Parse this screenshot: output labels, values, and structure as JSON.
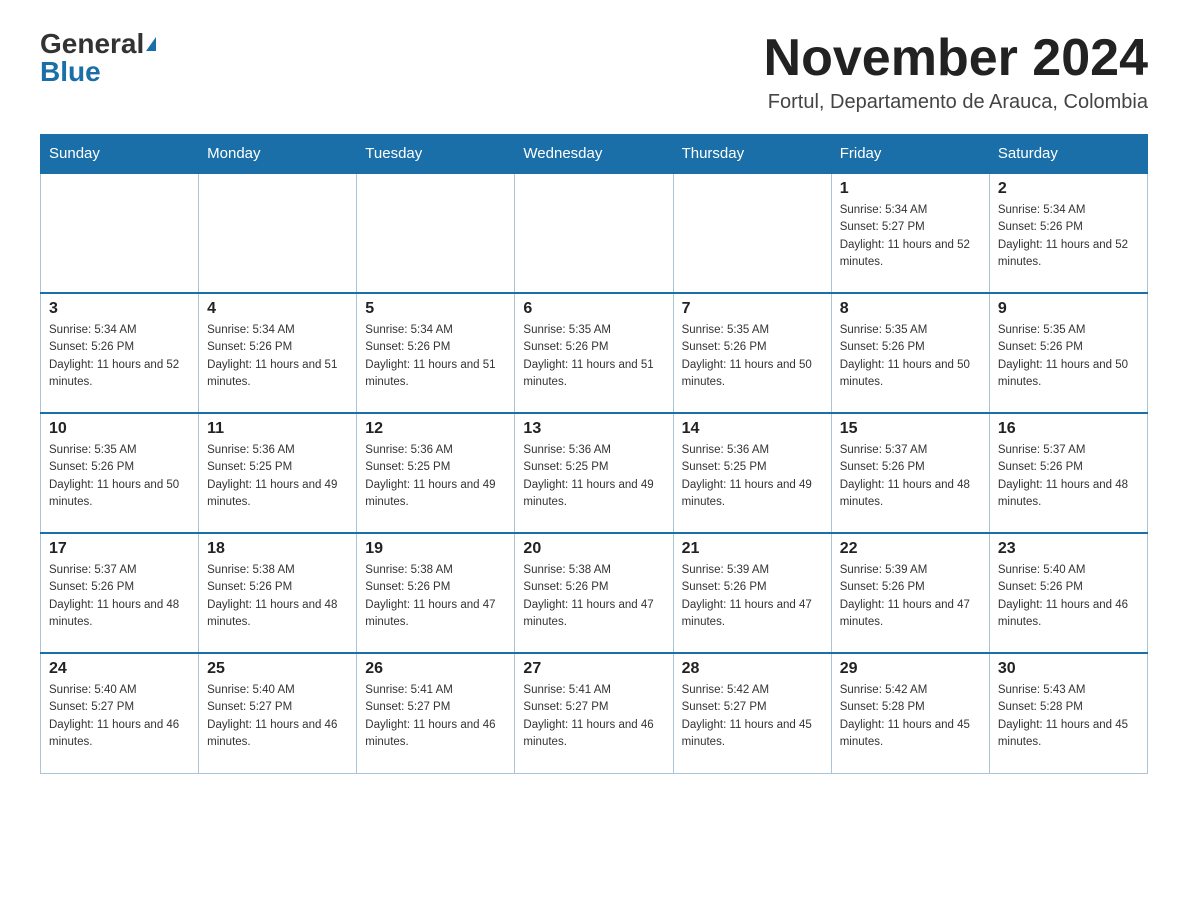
{
  "header": {
    "logo_general": "General",
    "logo_blue": "Blue",
    "month_title": "November 2024",
    "location": "Fortul, Departamento de Arauca, Colombia"
  },
  "days_of_week": [
    "Sunday",
    "Monday",
    "Tuesday",
    "Wednesday",
    "Thursday",
    "Friday",
    "Saturday"
  ],
  "weeks": [
    [
      {
        "day": "",
        "info": ""
      },
      {
        "day": "",
        "info": ""
      },
      {
        "day": "",
        "info": ""
      },
      {
        "day": "",
        "info": ""
      },
      {
        "day": "",
        "info": ""
      },
      {
        "day": "1",
        "info": "Sunrise: 5:34 AM\nSunset: 5:27 PM\nDaylight: 11 hours and 52 minutes."
      },
      {
        "day": "2",
        "info": "Sunrise: 5:34 AM\nSunset: 5:26 PM\nDaylight: 11 hours and 52 minutes."
      }
    ],
    [
      {
        "day": "3",
        "info": "Sunrise: 5:34 AM\nSunset: 5:26 PM\nDaylight: 11 hours and 52 minutes."
      },
      {
        "day": "4",
        "info": "Sunrise: 5:34 AM\nSunset: 5:26 PM\nDaylight: 11 hours and 51 minutes."
      },
      {
        "day": "5",
        "info": "Sunrise: 5:34 AM\nSunset: 5:26 PM\nDaylight: 11 hours and 51 minutes."
      },
      {
        "day": "6",
        "info": "Sunrise: 5:35 AM\nSunset: 5:26 PM\nDaylight: 11 hours and 51 minutes."
      },
      {
        "day": "7",
        "info": "Sunrise: 5:35 AM\nSunset: 5:26 PM\nDaylight: 11 hours and 50 minutes."
      },
      {
        "day": "8",
        "info": "Sunrise: 5:35 AM\nSunset: 5:26 PM\nDaylight: 11 hours and 50 minutes."
      },
      {
        "day": "9",
        "info": "Sunrise: 5:35 AM\nSunset: 5:26 PM\nDaylight: 11 hours and 50 minutes."
      }
    ],
    [
      {
        "day": "10",
        "info": "Sunrise: 5:35 AM\nSunset: 5:26 PM\nDaylight: 11 hours and 50 minutes."
      },
      {
        "day": "11",
        "info": "Sunrise: 5:36 AM\nSunset: 5:25 PM\nDaylight: 11 hours and 49 minutes."
      },
      {
        "day": "12",
        "info": "Sunrise: 5:36 AM\nSunset: 5:25 PM\nDaylight: 11 hours and 49 minutes."
      },
      {
        "day": "13",
        "info": "Sunrise: 5:36 AM\nSunset: 5:25 PM\nDaylight: 11 hours and 49 minutes."
      },
      {
        "day": "14",
        "info": "Sunrise: 5:36 AM\nSunset: 5:25 PM\nDaylight: 11 hours and 49 minutes."
      },
      {
        "day": "15",
        "info": "Sunrise: 5:37 AM\nSunset: 5:26 PM\nDaylight: 11 hours and 48 minutes."
      },
      {
        "day": "16",
        "info": "Sunrise: 5:37 AM\nSunset: 5:26 PM\nDaylight: 11 hours and 48 minutes."
      }
    ],
    [
      {
        "day": "17",
        "info": "Sunrise: 5:37 AM\nSunset: 5:26 PM\nDaylight: 11 hours and 48 minutes."
      },
      {
        "day": "18",
        "info": "Sunrise: 5:38 AM\nSunset: 5:26 PM\nDaylight: 11 hours and 48 minutes."
      },
      {
        "day": "19",
        "info": "Sunrise: 5:38 AM\nSunset: 5:26 PM\nDaylight: 11 hours and 47 minutes."
      },
      {
        "day": "20",
        "info": "Sunrise: 5:38 AM\nSunset: 5:26 PM\nDaylight: 11 hours and 47 minutes."
      },
      {
        "day": "21",
        "info": "Sunrise: 5:39 AM\nSunset: 5:26 PM\nDaylight: 11 hours and 47 minutes."
      },
      {
        "day": "22",
        "info": "Sunrise: 5:39 AM\nSunset: 5:26 PM\nDaylight: 11 hours and 47 minutes."
      },
      {
        "day": "23",
        "info": "Sunrise: 5:40 AM\nSunset: 5:26 PM\nDaylight: 11 hours and 46 minutes."
      }
    ],
    [
      {
        "day": "24",
        "info": "Sunrise: 5:40 AM\nSunset: 5:27 PM\nDaylight: 11 hours and 46 minutes."
      },
      {
        "day": "25",
        "info": "Sunrise: 5:40 AM\nSunset: 5:27 PM\nDaylight: 11 hours and 46 minutes."
      },
      {
        "day": "26",
        "info": "Sunrise: 5:41 AM\nSunset: 5:27 PM\nDaylight: 11 hours and 46 minutes."
      },
      {
        "day": "27",
        "info": "Sunrise: 5:41 AM\nSunset: 5:27 PM\nDaylight: 11 hours and 46 minutes."
      },
      {
        "day": "28",
        "info": "Sunrise: 5:42 AM\nSunset: 5:27 PM\nDaylight: 11 hours and 45 minutes."
      },
      {
        "day": "29",
        "info": "Sunrise: 5:42 AM\nSunset: 5:28 PM\nDaylight: 11 hours and 45 minutes."
      },
      {
        "day": "30",
        "info": "Sunrise: 5:43 AM\nSunset: 5:28 PM\nDaylight: 11 hours and 45 minutes."
      }
    ]
  ]
}
